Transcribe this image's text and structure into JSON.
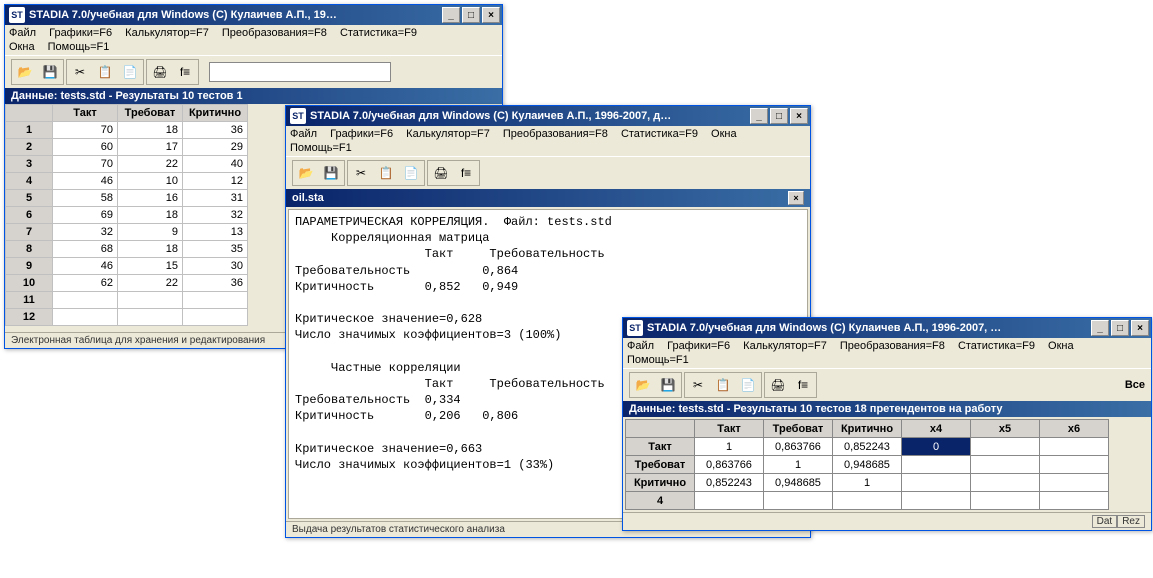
{
  "win1": {
    "title": "STADIA 7.0/учебная для Windows  (C) Кулаичев А.П., 19…",
    "menu": [
      "Файл",
      "Графики=F6",
      "Калькулятор=F7",
      "Преобразования=F8",
      "Статистика=F9"
    ],
    "menu2": [
      "Окна",
      "Помощь=F1"
    ],
    "subtitle": "Данные: tests.std - Результаты 10 тестов 1",
    "headers": [
      "",
      "Такт",
      "Требоват",
      "Критично"
    ],
    "rows": [
      [
        "1",
        "70",
        "18",
        "36"
      ],
      [
        "2",
        "60",
        "17",
        "29"
      ],
      [
        "3",
        "70",
        "22",
        "40"
      ],
      [
        "4",
        "46",
        "10",
        "12"
      ],
      [
        "5",
        "58",
        "16",
        "31"
      ],
      [
        "6",
        "69",
        "18",
        "32"
      ],
      [
        "7",
        "32",
        "9",
        "13"
      ],
      [
        "8",
        "68",
        "18",
        "35"
      ],
      [
        "9",
        "46",
        "15",
        "30"
      ],
      [
        "10",
        "62",
        "22",
        "36"
      ],
      [
        "11",
        "",
        "",
        ""
      ],
      [
        "12",
        "",
        "",
        ""
      ]
    ],
    "status": "Электронная таблица для хранения и редактирования"
  },
  "win2": {
    "title": "STADIA 7.0/учебная для Windows  (C) Кулаичев А.П., 1996-2007, д…",
    "menu": [
      "Файл",
      "Графики=F6",
      "Калькулятор=F7",
      "Преобразования=F8",
      "Статистика=F9",
      "Окна"
    ],
    "menu2": [
      "Помощь=F1"
    ],
    "subtitle": "oil.sta",
    "text": "ПАРАМЕТРИЧЕСКАЯ КОРРЕЛЯЦИЯ.  Файл: tests.std\n     Корреляционная матрица\n                  Такт     Требовательность\nТребовательность          0,864\nКритичность       0,852   0,949\n\nКритическое значение=0,628\nЧисло значимых коэффициентов=3 (100%)\n\n     Частные корреляции\n                  Такт     Требовательность\nТребовательность  0,334\nКритичность       0,206   0,806\n\nКритическое значение=0,663\nЧисло значимых коэффициентов=1 (33%)",
    "status": "Выдача результатов статистического анализа"
  },
  "win3": {
    "title": "STADIA 7.0/учебная для Windows  (C) Кулаичев А.П., 1996-2007, …",
    "menu": [
      "Файл",
      "Графики=F6",
      "Калькулятор=F7",
      "Преобразования=F8",
      "Статистика=F9",
      "Окна"
    ],
    "menu2": [
      "Помощь=F1"
    ],
    "extra": "Все",
    "subtitle": "Данные: tests.std - Результаты 10 тестов 18 претендентов на работу",
    "headers": [
      "",
      "Такт",
      "Требоват",
      "Критично",
      "x4",
      "x5",
      "x6"
    ],
    "rows": [
      [
        "Такт",
        "1",
        "0,863766",
        "0,852243",
        "0",
        "",
        ""
      ],
      [
        "Требоват",
        "0,863766",
        "1",
        "0,948685",
        "",
        "",
        ""
      ],
      [
        "Критично",
        "0,852243",
        "0,948685",
        "1",
        "",
        "",
        ""
      ],
      [
        "4",
        "",
        "",
        "",
        "",
        "",
        ""
      ]
    ],
    "dat": "Dat",
    "rez": "Rez"
  },
  "icons": {
    "open": "📂",
    "save": "💾",
    "cut": "✂",
    "copy": "📋",
    "paste": "📄",
    "print": "🖨",
    "func": "f≡"
  },
  "winbtns": {
    "min": "_",
    "max": "□",
    "close": "×"
  }
}
